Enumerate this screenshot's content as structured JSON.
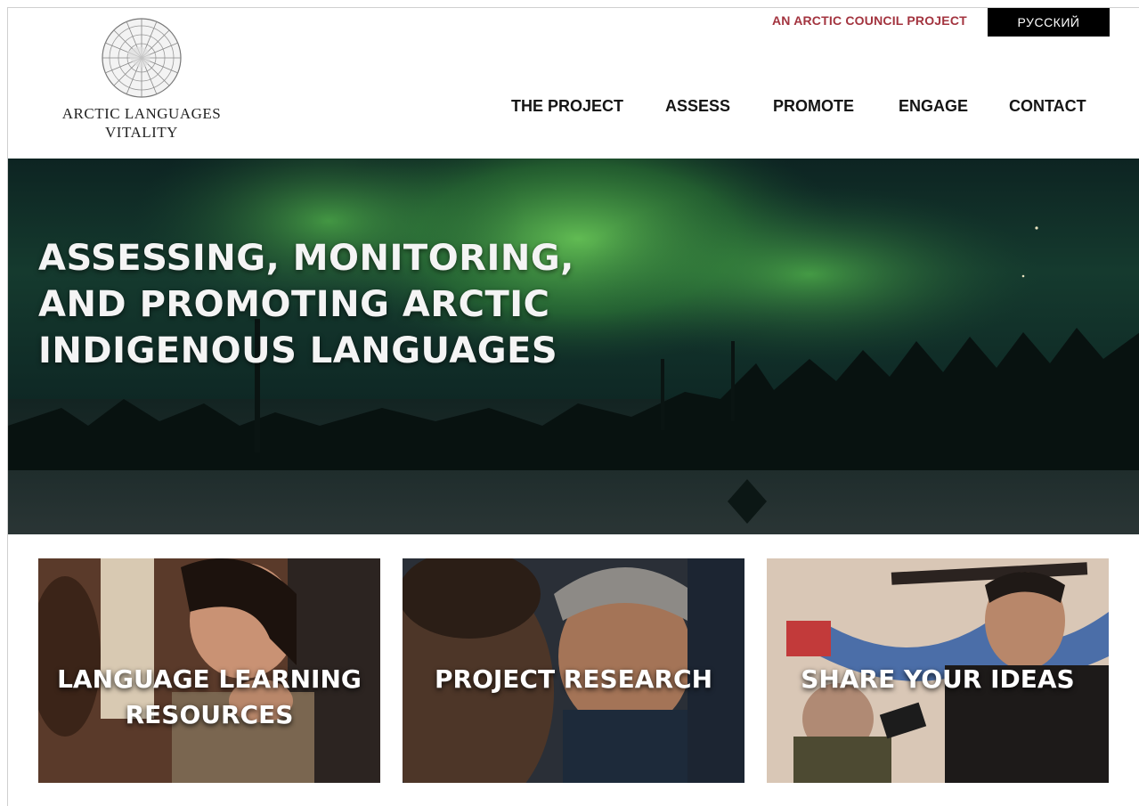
{
  "header": {
    "logo": {
      "line1": "ARCTIC LANGUAGES",
      "line2": "VITALITY"
    },
    "top_link": "AN ARCTIC COUNCIL PROJECT",
    "language_button": "РУССКИЙ",
    "nav": [
      {
        "label": "THE PROJECT"
      },
      {
        "label": "ASSESS"
      },
      {
        "label": "PROMOTE"
      },
      {
        "label": "ENGAGE"
      },
      {
        "label": "CONTACT"
      }
    ]
  },
  "hero": {
    "title_line1": "ASSESSING, MONITORING,",
    "title_line2": "AND PROMOTING ARCTIC",
    "title_line3": "INDIGENOUS LANGUAGES"
  },
  "cards": [
    {
      "line1": "LANGUAGE LEARNING",
      "line2": "RESOURCES"
    },
    {
      "line1": "PROJECT RESEARCH"
    },
    {
      "line1": "SHARE YOUR IDEAS"
    }
  ],
  "colors": {
    "accent_red": "#a3343f",
    "language_button_bg": "#000000",
    "aurora_green": "#4fbf4a"
  }
}
